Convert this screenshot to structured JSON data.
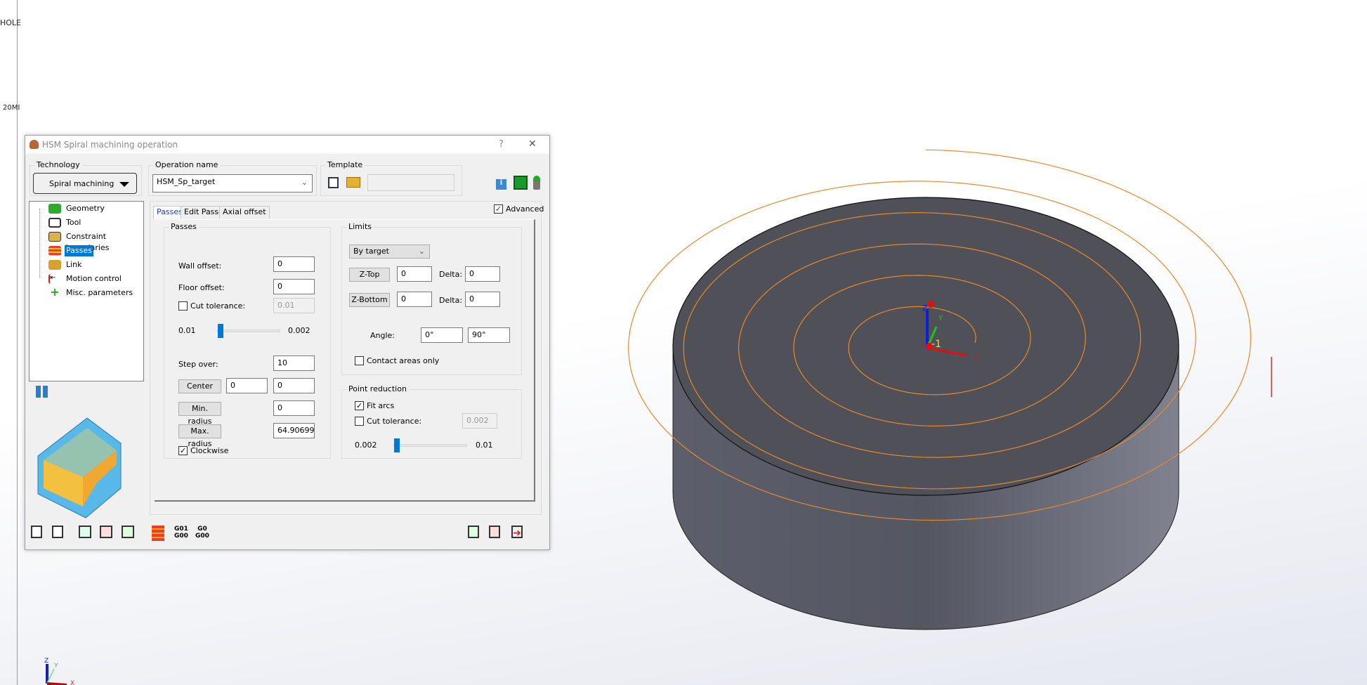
{
  "background": {
    "left_labels": [
      "HOLE",
      "20MI"
    ]
  },
  "colors": {
    "accent": "#0078d7",
    "toolpath": "#e8892a",
    "cylinder_top": "#4f5058",
    "cylinder_side": "#666a78"
  },
  "dialog": {
    "title": "HSM Spiral machining operation",
    "help": "?",
    "close": "✕",
    "technology": {
      "label": "Technology",
      "value": "Spiral machining"
    },
    "operation_name": {
      "label": "Operation name",
      "value": "HSM_Sp_target"
    },
    "template": {
      "label": "Template",
      "value": ""
    },
    "tree": [
      {
        "label": "Geometry",
        "icon": "geometry-icon",
        "color": "#2eaa2e"
      },
      {
        "label": "Tool",
        "icon": "tool-icon",
        "color": "#333"
      },
      {
        "label": "Constraint boundaries",
        "icon": "constraint-icon",
        "color": "#d9b44a"
      },
      {
        "label": "Passes",
        "icon": "passes-icon",
        "color": "#e8402a",
        "selected": true
      },
      {
        "label": "Link",
        "icon": "link-icon",
        "color": "#d9a030"
      },
      {
        "label": "Motion control",
        "icon": "motion-control-icon",
        "color": "#d02020"
      },
      {
        "label": "Misc. parameters",
        "icon": "plus-icon",
        "color": "#22b022"
      }
    ],
    "tabs": [
      "Passes",
      "Edit Passes",
      "Axial offset"
    ],
    "advanced": {
      "label": "Advanced",
      "checked": true
    },
    "passes": {
      "label": "Passes",
      "wall_offset_label": "Wall offset:",
      "wall_offset": "0",
      "floor_offset_label": "Floor offset:",
      "floor_offset": "0",
      "cut_tol_label": "Cut tolerance:",
      "cut_tol_checked": false,
      "cut_tol": "0.01",
      "slider_min": "0.01",
      "slider_max": "0.002",
      "slider_value": 0,
      "step_over_label": "Step over:",
      "step_over": "10",
      "center_label": "Center",
      "center_x": "0",
      "center_y": "0",
      "min_radius_label": "Min. radius",
      "min_radius": "0",
      "max_radius_label": "Max. radius",
      "max_radius": "64.90699",
      "clockwise_label": "Clockwise",
      "clockwise": true
    },
    "limits": {
      "label": "Limits",
      "mode": "By target",
      "ztop_label": "Z-Top",
      "ztop": "0",
      "ztop_delta_label": "Delta:",
      "ztop_delta": "0",
      "zbottom_label": "Z-Bottom",
      "zbottom": "0",
      "zbottom_delta_label": "Delta:",
      "zbottom_delta": "0",
      "angle_label": "Angle:",
      "angle1": "0°",
      "angle2": "90°",
      "contact_label": "Contact areas only",
      "contact": false
    },
    "point_reduction": {
      "label": "Point reduction",
      "fit_arcs_label": "Fit arcs",
      "fit_arcs": true,
      "cut_tol_label": "Cut tolerance:",
      "cut_tol_checked": false,
      "cut_tol": "0.002",
      "slider_min": "0.002",
      "slider_max": "0.01",
      "slider_value": 0
    },
    "toolbar": {
      "g1": "G01",
      "g2": "G00",
      "g3": "G0",
      "g4": "G00"
    }
  },
  "viewport": {
    "triad": {
      "x": "X",
      "y": "Y",
      "z": "Z"
    },
    "origin_label": "-1"
  }
}
